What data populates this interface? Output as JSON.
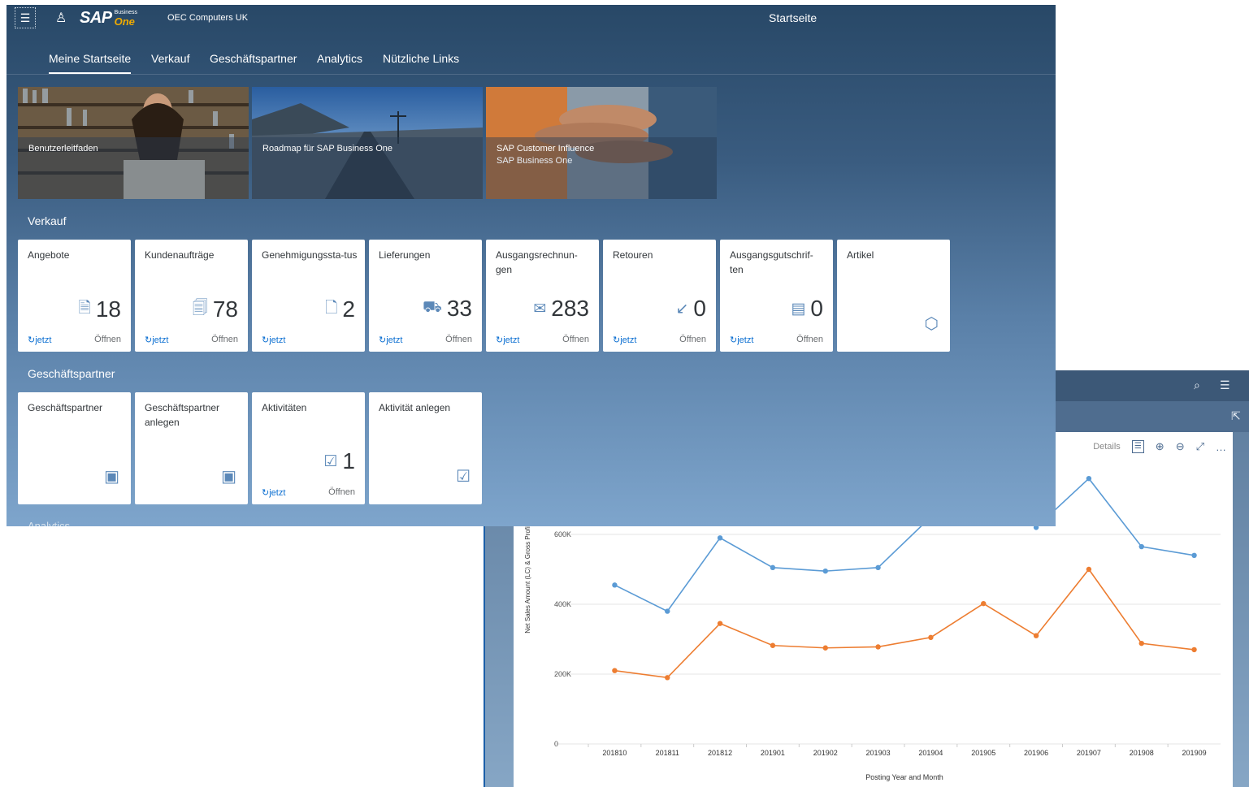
{
  "shell": {
    "logo_main": "SAP",
    "logo_small": "Business",
    "logo_one": "One",
    "company": "OEC Computers UK",
    "title": "Startseite"
  },
  "tabs": [
    "Meine Startseite",
    "Verkauf",
    "Geschäftspartner",
    "Analytics",
    "Nützliche Links"
  ],
  "news": [
    {
      "title": "Benutzerleitfaden",
      "subtitle": ""
    },
    {
      "title": "Roadmap für SAP Business One",
      "subtitle": ""
    },
    {
      "title": "SAP Customer Influence",
      "subtitle": "SAP Business One"
    }
  ],
  "sections": {
    "verkauf": "Verkauf",
    "geschaeftspartner": "Geschäftspartner",
    "analytics": "Analytics"
  },
  "verkauf_tiles": [
    {
      "title": "Angebote",
      "icon": "quote-icon",
      "glyph": "🗎",
      "value": "18",
      "refresh": "jetzt",
      "status": "Öffnen"
    },
    {
      "title": "Kundenaufträge",
      "icon": "sales-order-icon",
      "glyph": "🗐",
      "value": "78",
      "refresh": "jetzt",
      "status": "Öffnen"
    },
    {
      "title": "Genehmigungssta-tus",
      "icon": "document-icon",
      "glyph": "🗋",
      "value": "2",
      "refresh": "jetzt",
      "status": ""
    },
    {
      "title": "Lieferungen",
      "icon": "truck-icon",
      "glyph": "⛟",
      "value": "33",
      "refresh": "jetzt",
      "status": "Öffnen"
    },
    {
      "title": "Ausgangsrechnun-gen",
      "icon": "invoice-icon",
      "glyph": "✉",
      "value": "283",
      "refresh": "jetzt",
      "status": "Öffnen"
    },
    {
      "title": "Retouren",
      "icon": "return-icon",
      "glyph": "↙",
      "value": "0",
      "refresh": "jetzt",
      "status": "Öffnen"
    },
    {
      "title": "Ausgangsgutschrif-ten",
      "icon": "credit-memo-icon",
      "glyph": "▤",
      "value": "0",
      "refresh": "jetzt",
      "status": "Öffnen"
    },
    {
      "title": "Artikel",
      "icon": "item-box-icon",
      "glyph": "⬡",
      "value": "",
      "refresh": "",
      "status": ""
    }
  ],
  "gp_tiles": [
    {
      "title": "Geschäftspartner",
      "icon": "business-card-icon",
      "glyph": "▣",
      "value": "",
      "refresh": "",
      "status": ""
    },
    {
      "title": "Geschäftspartner anlegen",
      "icon": "add-business-card-icon",
      "glyph": "▣",
      "value": "",
      "refresh": "",
      "status": ""
    },
    {
      "title": "Aktivitäten",
      "icon": "task-list-icon",
      "glyph": "☑",
      "value": "1",
      "refresh": "jetzt",
      "status": "Öffnen"
    },
    {
      "title": "Aktivität anlegen",
      "icon": "add-task-icon",
      "glyph": "☑",
      "value": "",
      "refresh": "",
      "status": ""
    }
  ],
  "chart_toolbar": {
    "details": "Details"
  },
  "chart_data": {
    "type": "line",
    "x": [
      "201810",
      "201811",
      "201812",
      "201901",
      "201902",
      "201903",
      "201904",
      "201905",
      "201906",
      "201907",
      "201908",
      "201909"
    ],
    "series": [
      {
        "color": "#5b9bd5",
        "values": [
          455000,
          380000,
          590000,
          505000,
          495000,
          505000,
          650000,
          740000,
          620000,
          760000,
          565000,
          540000
        ]
      },
      {
        "color": "#ed7d31",
        "values": [
          210000,
          190000,
          345000,
          282000,
          275000,
          278000,
          305000,
          402000,
          310000,
          500000,
          288000,
          270000
        ]
      }
    ],
    "xlabel": "Posting Year and Month",
    "ylabel": "Net Sales Amount (LC) & Gross Profit (LC)",
    "yticks": [
      "0",
      "200K",
      "400K",
      "600K"
    ],
    "ylim": [
      0,
      800000
    ],
    "grid": true
  }
}
